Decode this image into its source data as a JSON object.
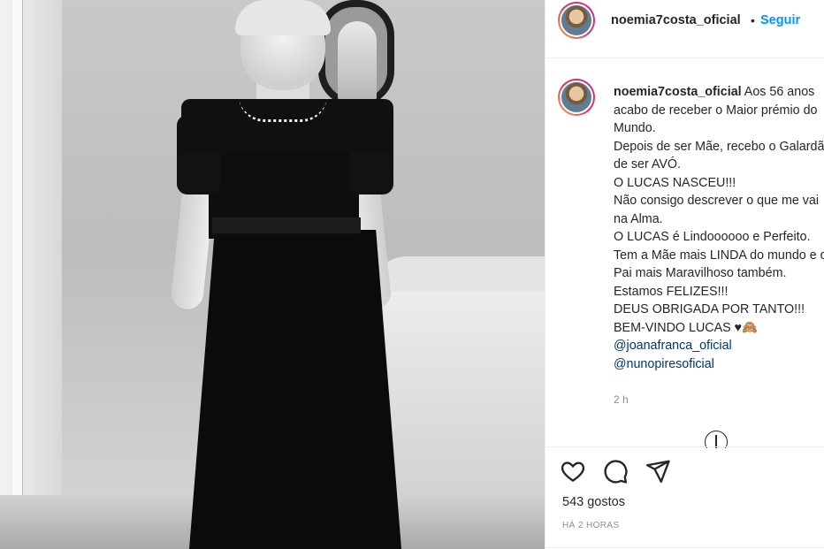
{
  "header": {
    "username": "noemia7costa_oficial",
    "separator": "•",
    "follow_label": "Seguir"
  },
  "post": {
    "caption_username": "noemia7costa_oficial",
    "caption_text": " Aos 56 anos acabo de receber o Maior prémio do Mundo.\nDepois de ser Mãe, recebo o Galardão de ser AVÓ.\nO LUCAS NASCEU!!!\nNão consigo descrever o que me vai na Alma.\nO LUCAS é Lindoooooo e Perfeito.\nTem a Mãe mais LINDA do mundo e o Pai mais Maravilhoso também.\nEstamos FELIZES!!!\nDEUS OBRIGADA POR TANTO!!!\nBEM-VINDO LUCAS ♥🙈",
    "mentions": [
      "@joanafranca_oficial",
      "@nunopiresoficial"
    ],
    "caption_time": "2 h",
    "likes": "543 gostos",
    "posted_ago": "HÁ 2 HORAS"
  },
  "icons": {
    "like": "heart-icon",
    "comment": "comment-icon",
    "share": "share-icon",
    "more": "more-comments-icon"
  },
  "colors": {
    "link_blue": "#0095f6",
    "mention_blue": "#00376b",
    "text": "#262626",
    "muted": "#8e8e8e"
  }
}
